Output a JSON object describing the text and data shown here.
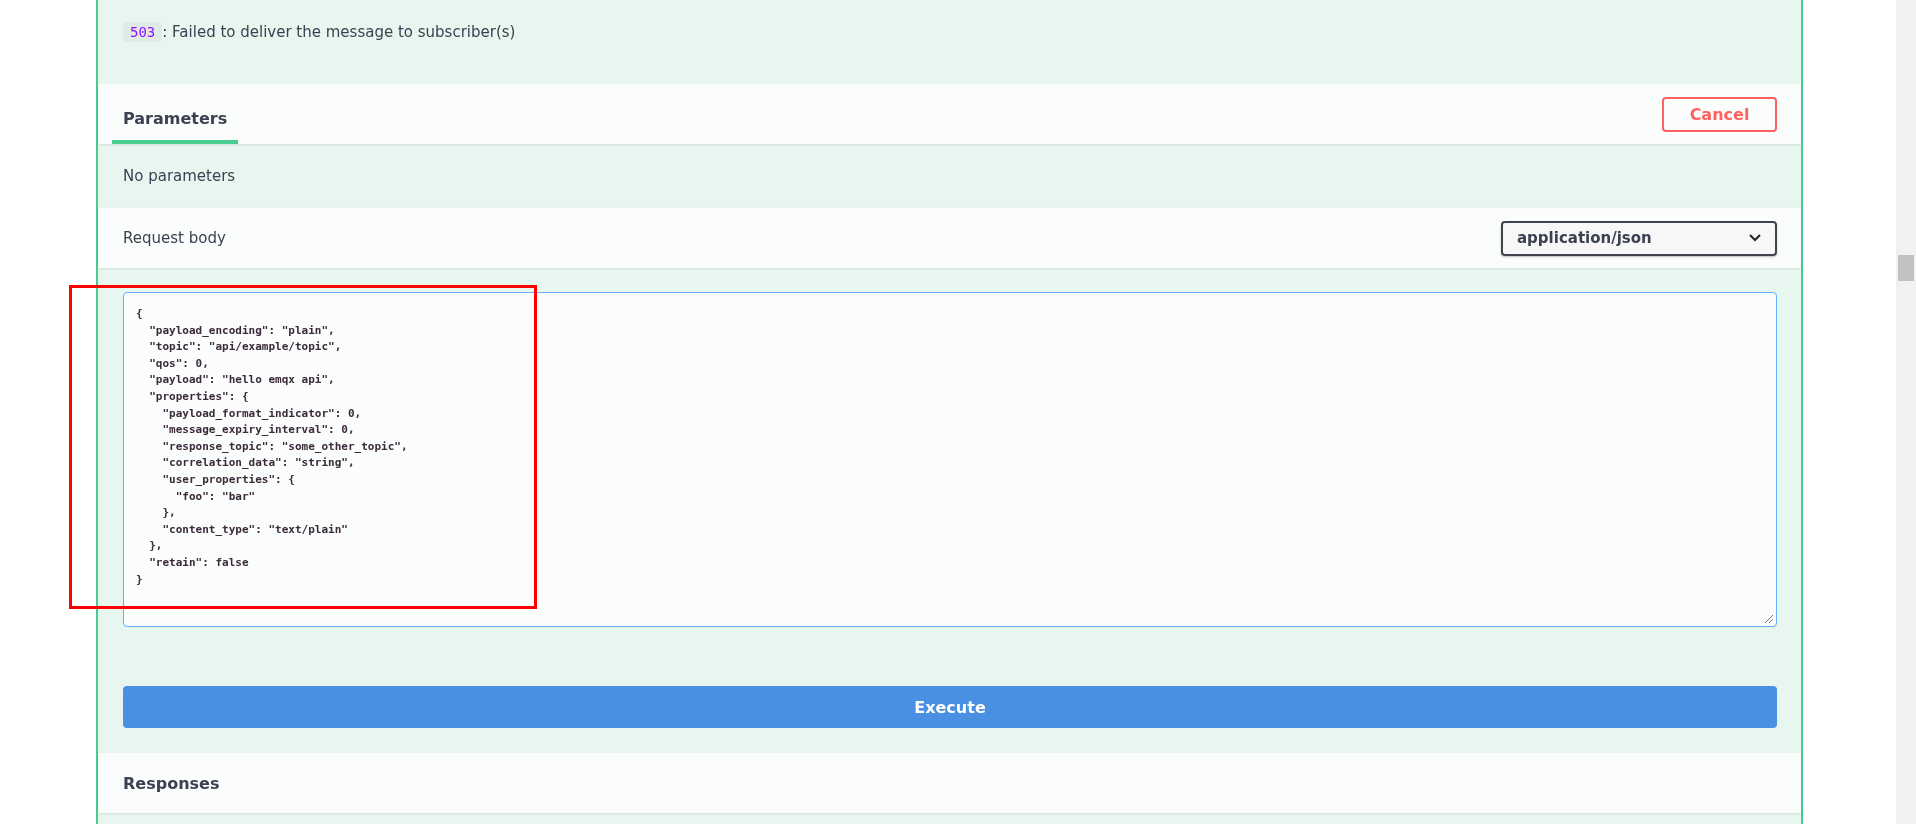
{
  "response_codes": [
    {
      "code": "503",
      "description": ": Failed to deliver the message to subscriber(s)"
    }
  ],
  "tabs": [
    {
      "label": "Parameters",
      "selected": true
    }
  ],
  "cancel_button": {
    "label": "Cancel"
  },
  "parameters": {
    "empty_text": "No parameters"
  },
  "request_body": {
    "label": "Request body",
    "content_type": "application/json",
    "value": "{\n  \"payload_encoding\": \"plain\",\n  \"topic\": \"api/example/topic\",\n  \"qos\": 0,\n  \"payload\": \"hello emqx api\",\n  \"properties\": {\n    \"payload_format_indicator\": 0,\n    \"message_expiry_interval\": 0,\n    \"response_topic\": \"some_other_topic\",\n    \"correlation_data\": \"string\",\n    \"user_properties\": {\n      \"foo\": \"bar\"\n    },\n    \"content_type\": \"text/plain\"\n  },\n  \"retain\": false\n}"
  },
  "execute_button": {
    "label": "Execute"
  },
  "responses": {
    "title": "Responses"
  }
}
